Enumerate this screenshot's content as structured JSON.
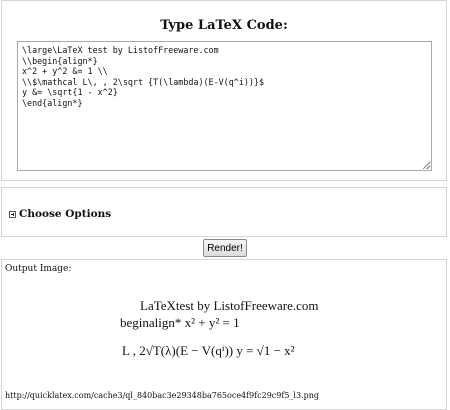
{
  "input_panel": {
    "heading": "Type LaTeX Code:",
    "code": "\\large\\LaTeX test by ListofFreeware.com\n\\\\begin{align*}\nx^2 + y^2 &= 1 \\\\\n\\\\$\\mathcal L\\, , 2\\sqrt {T(\\lambda)(E-V(q^i))}$\ny &= \\sqrt{1 - x^2}\n\\end{align*}"
  },
  "options_panel": {
    "label": "Choose Options",
    "toggle_icon": "plus-box-icon"
  },
  "render_button": {
    "label": "Render!"
  },
  "output_panel": {
    "label": "Output Image:",
    "rendered_lines": [
      "LaTeXtest by ListofFreeware.com",
      "beginalign* x² + y² = 1",
      "L , 2√T(λ)(E − V(qⁱ)) y = √1 − x²"
    ],
    "url": "http://quicklatex.com/cache3/ql_840bac3e29348ba765oce4f9fc29c9f5_l3.png"
  }
}
